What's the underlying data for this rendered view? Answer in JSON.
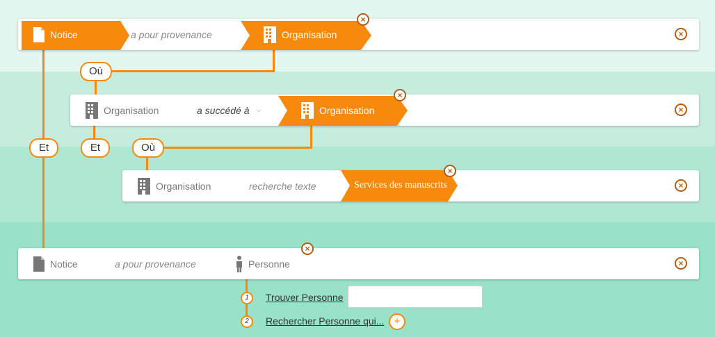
{
  "colors": {
    "accent": "#f7890c",
    "remove": "#b05f18"
  },
  "row1": {
    "subject": "Notice",
    "predicate": "a pour provenance",
    "object": "Organisation"
  },
  "row2": {
    "subject": "Organisation",
    "predicate": "a succédé à",
    "object": "Organisation"
  },
  "row3": {
    "subject": "Organisation",
    "predicate": "recherche texte",
    "object": "Services des manuscrits"
  },
  "row4": {
    "subject": "Notice",
    "predicate": "a pour provenance",
    "object": "Personne"
  },
  "connectors": {
    "ou1": "Où",
    "et_outer": "Et",
    "et_inner": "Et",
    "ou2": "Où"
  },
  "options": {
    "opt1": {
      "number": "1",
      "label": "Trouver Personne",
      "input_value": ""
    },
    "opt2": {
      "number": "2",
      "label": "Rechercher Personne qui...",
      "add": "+"
    }
  },
  "remove_glyph": "×"
}
